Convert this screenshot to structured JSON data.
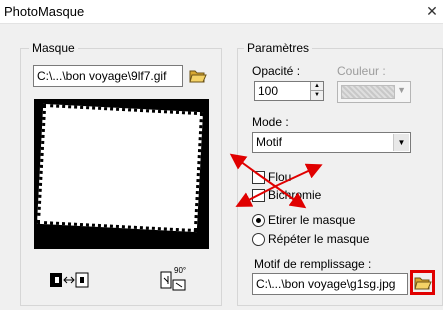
{
  "window": {
    "title": "PhotoMasque",
    "close_glyph": "✕"
  },
  "masque": {
    "group_label": "Masque",
    "file_value": "C:\\...\\bon voyage\\9lf7.gif",
    "open_icon": "folder-open-icon",
    "invert_icon": "invert-mask-icon",
    "rotate_icon": "rotate-90-icon",
    "rotate_label": "90°"
  },
  "parametres": {
    "group_label": "Paramètres",
    "opacite_label": "Opacité :",
    "opacite_value": "100",
    "couleur_label": "Couleur :",
    "mode_label": "Mode :",
    "mode_value": "Motif",
    "flou_label": "Flou",
    "bichromie_label": "Bichromie",
    "etirer_label": "Etirer le masque",
    "repeter_label": "Répéter le masque",
    "motif_label": "Motif de remplissage :",
    "motif_value": "C:\\...\\bon voyage\\g1sg.jpg"
  },
  "colors": {
    "annotation_red": "#e00000"
  }
}
